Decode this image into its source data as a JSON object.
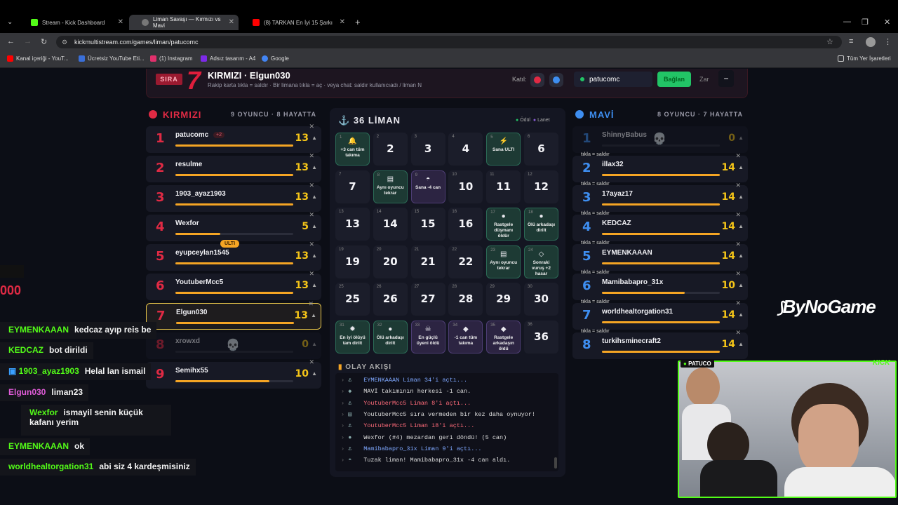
{
  "browser": {
    "tabs": [
      {
        "title": "Stream - Kick Dashboard",
        "color": "#53fc18"
      },
      {
        "title": "Liman Savaşı — Kırmızı vs Mavi",
        "color": "#888888"
      },
      {
        "title": "(8) TARKAN En İyi 15 Şarkı",
        "color": "#ff0000"
      }
    ],
    "url": "kickmultistream.com/games/liman/patucomc",
    "bookmarks": [
      {
        "label": "Kanal içeriği - YouT...",
        "color": "#ff0000"
      },
      {
        "label": "Ücretsiz YouTube Eti...",
        "color": "#3a6fd8"
      },
      {
        "label": "(1) Instagram",
        "color": "#e1306c"
      },
      {
        "label": "Adsız tasarım - A4",
        "color": "#7d2ae8"
      },
      {
        "label": "Google",
        "color": "#4285f4"
      }
    ],
    "all_bookmarks": "Tüm Yer İşaretleri"
  },
  "turn": {
    "badge": "SIRA",
    "number": "7",
    "title": "KIRMIZI · Elgun030",
    "hint": "Rakip karta tıkla = saldır · Bir limana tıkla = aç · veya chat: saldır kullanıcıadı / liman N",
    "join_label": "Katıl:",
    "username": "patucomc",
    "connect": "Bağlan",
    "dice": "Zar",
    "minus": "−",
    "red_color": "#e02a44",
    "blue_color": "#3e8ef0"
  },
  "red_team": {
    "name": "KIRMIZI",
    "info": "9 OYUNCU · 8 HAYATTA",
    "players": [
      {
        "n": "1",
        "name": "patucomc",
        "tag": "+2",
        "hp": "13",
        "fill": 1.0
      },
      {
        "n": "2",
        "name": "resulme",
        "hp": "13",
        "fill": 1.0
      },
      {
        "n": "3",
        "name": "1903_ayaz1903",
        "hp": "13",
        "fill": 1.0
      },
      {
        "n": "4",
        "name": "Wexfor",
        "hp": "5",
        "fill": 0.38
      },
      {
        "n": "5",
        "name": "eyupceylan1545",
        "tag": "ULTI",
        "hp": "13",
        "fill": 1.0
      },
      {
        "n": "6",
        "name": "YoutuberMcc5",
        "hp": "13",
        "fill": 1.0
      },
      {
        "n": "7",
        "name": "Elgun030",
        "hp": "13",
        "fill": 1.0
      },
      {
        "n": "8",
        "name": "xrowxd",
        "hp": "0",
        "fill": 0
      },
      {
        "n": "9",
        "name": "Semihx55",
        "hp": "10",
        "fill": 0.8
      }
    ]
  },
  "blue_team": {
    "name": "MAVİ",
    "info": "8 OYUNCU · 7 HAYATTA",
    "hint": "tıkla = saldır",
    "players": [
      {
        "n": "1",
        "name": "ShinnyBabus",
        "hp": "0",
        "fill": 0
      },
      {
        "n": "2",
        "name": "illax32",
        "hp": "14",
        "fill": 1.0
      },
      {
        "n": "3",
        "name": "17ayaz17",
        "hp": "14",
        "fill": 1.0
      },
      {
        "n": "4",
        "name": "KEDCAZ",
        "hp": "14",
        "fill": 1.0
      },
      {
        "n": "5",
        "name": "EYMENKAAAN",
        "hp": "14",
        "fill": 1.0
      },
      {
        "n": "6",
        "name": "Mamibabapro_31x",
        "hp": "10",
        "fill": 0.7
      },
      {
        "n": "7",
        "name": "worldhealtorgation31",
        "hp": "14",
        "fill": 1.0
      },
      {
        "n": "8",
        "name": "turkihsminecraft2",
        "hp": "14",
        "fill": 1.0
      }
    ]
  },
  "board": {
    "title": "36 LİMAN",
    "legend_reward": "Ödül",
    "legend_curse": "Lanet",
    "cells": [
      {
        "n": "1",
        "type": "g",
        "icon": "🔔",
        "label": "+3 can tüm takıma"
      },
      {
        "n": "2",
        "big": "2"
      },
      {
        "n": "3",
        "big": "3"
      },
      {
        "n": "4",
        "big": "4"
      },
      {
        "n": "5",
        "type": "g",
        "icon": "⚡",
        "label": "Sana ULTI"
      },
      {
        "n": "6",
        "big": "6"
      },
      {
        "n": "7",
        "big": "7"
      },
      {
        "n": "8",
        "type": "g",
        "icon": "▤",
        "label": "Aynı oyuncu tekrar"
      },
      {
        "n": "9",
        "type": "p",
        "icon": "◓",
        "label": "Sana -4 can"
      },
      {
        "n": "10",
        "big": "10"
      },
      {
        "n": "11",
        "big": "11"
      },
      {
        "n": "12",
        "big": "12"
      },
      {
        "n": "13",
        "big": "13"
      },
      {
        "n": "14",
        "big": "14"
      },
      {
        "n": "15",
        "big": "15"
      },
      {
        "n": "16",
        "big": "16"
      },
      {
        "n": "17",
        "type": "g",
        "icon": "●",
        "label": "Rastgele düşmanı öldür"
      },
      {
        "n": "18",
        "type": "g",
        "icon": "●",
        "label": "Ölü arkadaşı dirilt"
      },
      {
        "n": "19",
        "big": "19"
      },
      {
        "n": "20",
        "big": "20"
      },
      {
        "n": "21",
        "big": "21"
      },
      {
        "n": "22",
        "big": "22"
      },
      {
        "n": "23",
        "type": "g",
        "icon": "▤",
        "label": "Aynı oyuncu tekrar"
      },
      {
        "n": "24",
        "type": "g",
        "icon": "◇",
        "label": "Sonraki vuruş +2 hasar"
      },
      {
        "n": "25",
        "big": "25"
      },
      {
        "n": "26",
        "big": "26"
      },
      {
        "n": "27",
        "big": "27"
      },
      {
        "n": "28",
        "big": "28"
      },
      {
        "n": "29",
        "big": "29"
      },
      {
        "n": "30",
        "big": "30"
      },
      {
        "n": "31",
        "type": "g",
        "icon": "✹",
        "label": "En iyi ölüyü tam dirilt"
      },
      {
        "n": "32",
        "type": "g",
        "icon": "●",
        "label": "Ölü arkadaşı dirilt"
      },
      {
        "n": "33",
        "type": "p",
        "icon": "☠",
        "label": "En güçlü üyeni öldü"
      },
      {
        "n": "34",
        "type": "p",
        "icon": "◆",
        "label": "-1 can tüm takıma"
      },
      {
        "n": "35",
        "type": "p",
        "icon": "◆",
        "label": "Rastgele arkadaşın öldü"
      },
      {
        "n": "36",
        "big": "36"
      }
    ]
  },
  "events": {
    "title": "OLAY AKIŞI",
    "items": [
      {
        "icon": "⚓",
        "text": "EYMENKAAAN Liman 34'i açtı...",
        "color": "#7fa8ff"
      },
      {
        "icon": "◆",
        "text": "MAVİ takımının herkesi -1 can.",
        "color": "#dddddd"
      },
      {
        "icon": "⚓",
        "text": "YoutuberMcc5 Liman 8'i açtı...",
        "color": "#ff6b7a"
      },
      {
        "icon": "▤",
        "text": "YoutuberMcc5 sıra vermeden bir kez daha oynuyor!",
        "color": "#dddddd"
      },
      {
        "icon": "⚓",
        "text": "YoutuberMcc5 Liman 18'i açtı...",
        "color": "#ff6b7a"
      },
      {
        "icon": "●",
        "text": "Wexfor (#4) mezardan geri döndü! (5 can)",
        "color": "#dddddd"
      },
      {
        "icon": "⚓",
        "text": "Mamibabapro_31x Liman 9'i açtı...",
        "color": "#7fa8ff"
      },
      {
        "icon": "◓",
        "text": "Tuzak liman! Mamibabapro_31x -4 can aldı.",
        "color": "#dddddd"
      }
    ]
  },
  "chat": [
    {
      "user": "EYMENKAAAN",
      "msg": "kedcaz ayıp reis be",
      "color": "#53fc18"
    },
    {
      "user": "KEDCAZ",
      "msg": "bot dirildi",
      "color": "#53fc18"
    },
    {
      "user": "1903_ayaz1903",
      "msg": "Helal lan ismail",
      "color": "#53fc18"
    },
    {
      "user": "Elgun030",
      "msg": "liman23",
      "color": "#e05cd8"
    },
    {
      "user": "Wexfor",
      "msg": "ismayil senin küçük kafanı yerim",
      "color": "#53fc18"
    },
    {
      "user": "EYMENKAAAN",
      "msg": "ok",
      "color": "#53fc18"
    },
    {
      "user": "worldhealtorgation31",
      "msg": "abi siz 4 kardeşmisiniz",
      "color": "#53fc18"
    }
  ],
  "overlay": {
    "cam_label": "PATUCO",
    "kick_label": "KICK",
    "sponsor": "ByNoGame",
    "score_fragment": "000"
  }
}
